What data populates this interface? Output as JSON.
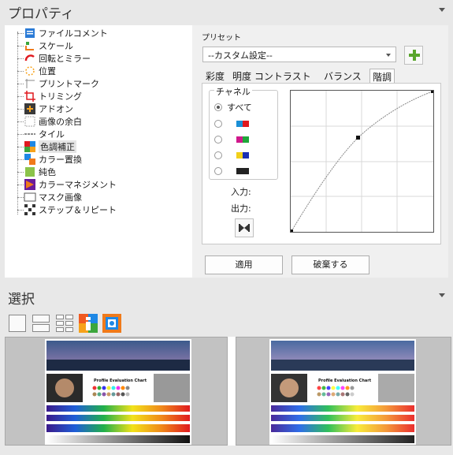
{
  "properties": {
    "title": "プロパティ",
    "tree_items": [
      {
        "label": "ファイルコメント",
        "icon": "file-comment-icon"
      },
      {
        "label": "スケール",
        "icon": "scale-icon"
      },
      {
        "label": "回転とミラー",
        "icon": "rotate-mirror-icon"
      },
      {
        "label": "位置",
        "icon": "position-icon"
      },
      {
        "label": "プリントマーク",
        "icon": "print-mark-icon"
      },
      {
        "label": "トリミング",
        "icon": "crop-icon"
      },
      {
        "label": "アドオン",
        "icon": "addon-icon"
      },
      {
        "label": "画像の余白",
        "icon": "image-margin-icon"
      },
      {
        "label": "タイル",
        "icon": "tile-icon"
      },
      {
        "label": "色調補正",
        "icon": "color-correction-icon"
      },
      {
        "label": "カラー置換",
        "icon": "color-replace-icon"
      },
      {
        "label": "純色",
        "icon": "solid-color-icon"
      },
      {
        "label": "カラーマネジメント",
        "icon": "color-management-icon"
      },
      {
        "label": "マスク画像",
        "icon": "mask-image-icon"
      },
      {
        "label": "ステップ＆リピート",
        "icon": "step-repeat-icon"
      }
    ],
    "selected_item": "色調補正",
    "preset_label": "プリセット",
    "preset_value": "--カスタム設定--",
    "tabs": [
      "彩度",
      "明度 コントラスト",
      "バランス",
      "階調"
    ],
    "active_tab": "階調",
    "channel": {
      "legend": "チャネル",
      "all_label": "すべて",
      "options": [
        {
          "name": "all",
          "colors": []
        },
        {
          "name": "cyan-red",
          "colors": [
            "#1a8fd6",
            "#e0191f"
          ]
        },
        {
          "name": "magenta-green",
          "colors": [
            "#d0188c",
            "#1fa83a"
          ]
        },
        {
          "name": "yellow-blue",
          "colors": [
            "#f2d01a",
            "#1b2fb3"
          ]
        },
        {
          "name": "black",
          "colors": [
            "#222222"
          ]
        }
      ],
      "selected": "all"
    },
    "input_label": "入力:",
    "output_label": "出力:",
    "apply_label": "適用",
    "discard_label": "破棄する"
  },
  "selection": {
    "title": "選択",
    "toolbar_icons": [
      "single-view-icon",
      "two-row-view-icon",
      "grid-view-icon",
      "info-icon",
      "settings-photo-icon"
    ],
    "thumbnail_text": "Profile Evaluation Chart"
  },
  "colors": {
    "accent_orange": "#f07a1a",
    "accent_blue": "#1e88e5",
    "add_green": "#59a52c"
  }
}
